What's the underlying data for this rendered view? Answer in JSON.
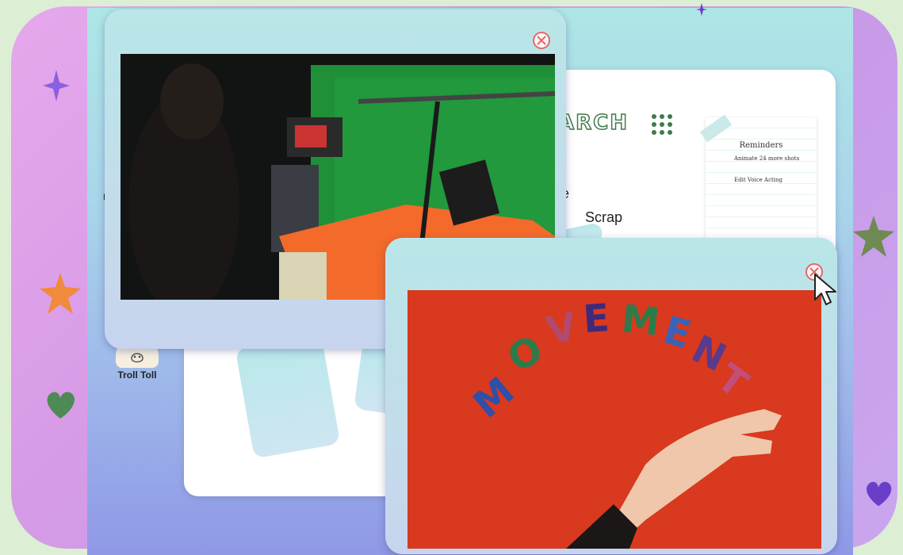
{
  "colors": {
    "frame_pink": "#d79be6",
    "desktop_teal": "#aee6e6",
    "window_teal": "#b9e6e8",
    "close_red": "#e06a6a",
    "title_green": "#3e7a4a",
    "studio_green": "#1f8f38",
    "counter_orange": "#f36a2a",
    "backdrop_red": "#d8391f"
  },
  "decorations": [
    "sparkle-icon",
    "star-icon",
    "heart-icon"
  ],
  "document_window": {
    "title_fragment": "ARCH",
    "line_fragment": "e",
    "scrap_label": "Scrap",
    "notes": {
      "title": "Reminders",
      "items": [
        "Animate 24 more shots",
        "Edit Voice Acting"
      ]
    }
  },
  "desktop_icons": [
    {
      "label": "Troll Toll",
      "icon": "troll-icon"
    }
  ],
  "desktop_edge_text": "D",
  "video_windows": [
    {
      "name": "green-screen-studio-video",
      "close_icon": "close-icon"
    },
    {
      "name": "movement-letters-video",
      "close_icon": "close-icon",
      "letters": "MOVEMENT"
    }
  ]
}
